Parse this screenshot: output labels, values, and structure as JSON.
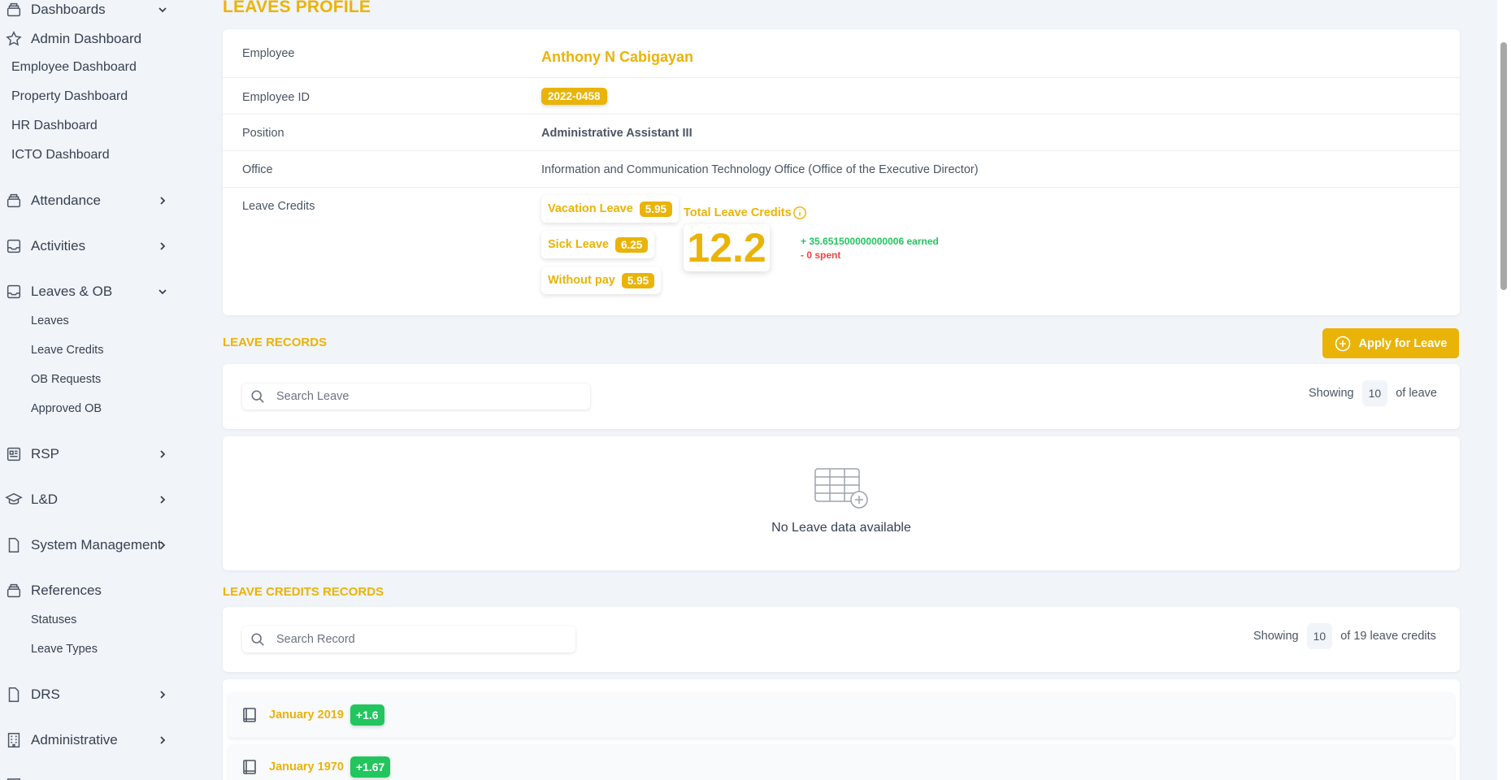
{
  "sidebar": {
    "dashboards": "Dashboards",
    "admin_dashboard": "Admin Dashboard",
    "employee_dashboard": "Employee Dashboard",
    "property_dashboard": "Property Dashboard",
    "hr_dashboard": "HR Dashboard",
    "icto_dashboard": "ICTO Dashboard",
    "attendance": "Attendance",
    "activities": "Activities",
    "leaves_ob": "Leaves & OB",
    "leaves": "Leaves",
    "leave_credits": "Leave Credits",
    "ob_requests": "OB Requests",
    "approved_ob": "Approved OB",
    "rsp": "RSP",
    "ld": "L&D",
    "system_management": "System Management",
    "references": "References",
    "statuses": "Statuses",
    "leave_types": "Leave Types",
    "drs": "DRS",
    "administrative": "Administrative"
  },
  "page": {
    "title": "LEAVES PROFILE"
  },
  "profile": {
    "employee_label": "Employee",
    "employee_name": "Anthony N Cabigayan",
    "id_label": "Employee ID",
    "id_value": "2022-0458",
    "position_label": "Position",
    "position_value": "Administrative Assistant III",
    "office_label": "Office",
    "office_value": "Information and Communication Technology Office (Office of the Executive Director)",
    "credits_label": "Leave Credits",
    "vacation_label": "Vacation Leave",
    "vacation_value": "5.95",
    "sick_label": "Sick Leave",
    "sick_value": "6.25",
    "without_pay_label": "Without pay",
    "without_pay_value": "5.95",
    "total_label": "Total Leave Credits",
    "total_value": "12.2",
    "earned": "+ 35.651500000000006 earned",
    "spent": "- 0 spent"
  },
  "leave_records": {
    "title": "LEAVE RECORDS",
    "apply_button": "Apply for Leave",
    "search_placeholder": "Search Leave",
    "showing_label": "Showing",
    "showing_count": "10",
    "showing_suffix": "of leave",
    "empty_text": "No Leave data available"
  },
  "credit_records": {
    "title": "LEAVE CREDITS RECORDS",
    "search_placeholder": "Search Record",
    "showing_label": "Showing",
    "showing_count": "10",
    "showing_suffix": "of 19 leave credits",
    "rows": [
      {
        "label": "January 2019",
        "badge": "+1.6"
      },
      {
        "label": "January 1970",
        "badge": "+1.67"
      }
    ]
  },
  "colors": {
    "accent": "#eab308",
    "success": "#22c55e",
    "danger": "#ef4444",
    "background": "#f1f4f8"
  }
}
